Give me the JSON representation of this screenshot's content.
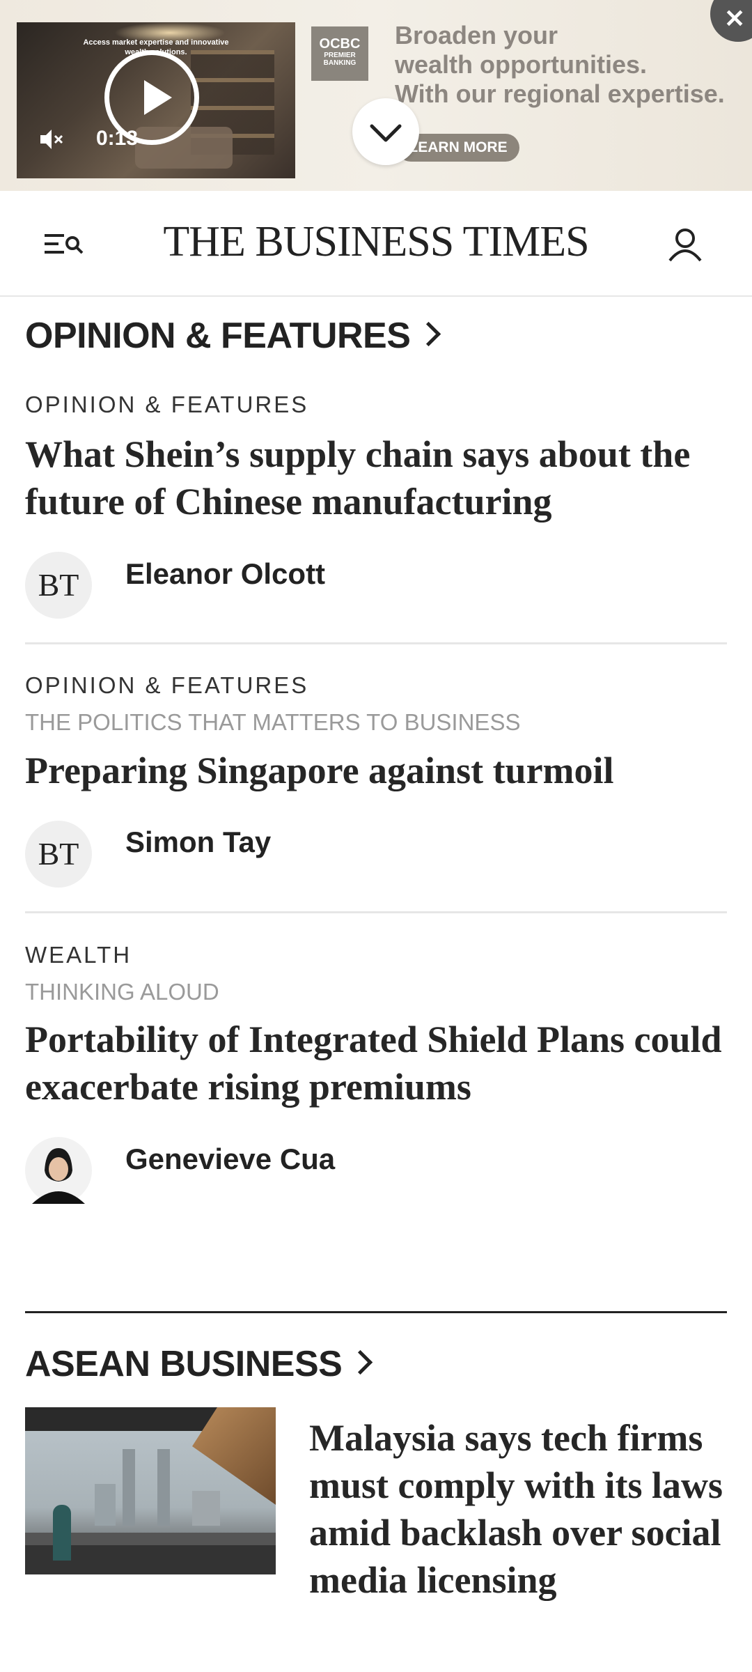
{
  "ad": {
    "video_blurb": "Access market expertise and innovative wealth solutions.",
    "timer": "0:13",
    "logo_line1": "OCBC",
    "logo_line2": "PREMIER",
    "logo_line3": "BANKING",
    "headline_lines": [
      "Broaden your",
      "wealth opportunities.",
      "With our regional expertise."
    ],
    "cta": "LEARN MORE",
    "close": "✕"
  },
  "header": {
    "logo": "THE BUSINESS TIMES"
  },
  "sections": {
    "opinion": {
      "title": "OPINION & FEATURES",
      "articles": [
        {
          "kicker": "OPINION & FEATURES",
          "subkicker": "",
          "headline": "What Shein’s supply chain says about the future of Chinese manufacturing",
          "avatar_text": "BT",
          "author": "Eleanor Olcott"
        },
        {
          "kicker": "OPINION & FEATURES",
          "subkicker": "THE POLITICS THAT MATTERS TO BUSINESS",
          "headline": "Preparing Singapore against turmoil",
          "avatar_text": "BT",
          "author": "Simon Tay"
        },
        {
          "kicker": "WEALTH",
          "subkicker": "THINKING ALOUD",
          "headline": "Portability of Integrated Shield Plans could exacerbate rising premiums",
          "avatar_text": "",
          "author": "Genevieve Cua"
        }
      ]
    },
    "asean": {
      "title": "ASEAN BUSINESS",
      "articles": [
        {
          "headline": "Malaysia says tech firms must comply with its laws amid backlash over social media licensing"
        }
      ]
    }
  },
  "icons": {
    "play": "play-icon",
    "mute": "muted-speaker-icon",
    "collapse": "chevron-down-icon",
    "close": "close-icon",
    "menu": "menu-search-icon",
    "user": "user-icon",
    "section_arrow": "chevron-right-icon"
  },
  "colors": {
    "ad_bg": "#efe9df",
    "ad_text": "#8c8680",
    "text_primary": "#222222",
    "text_muted": "#9a9a9a"
  }
}
